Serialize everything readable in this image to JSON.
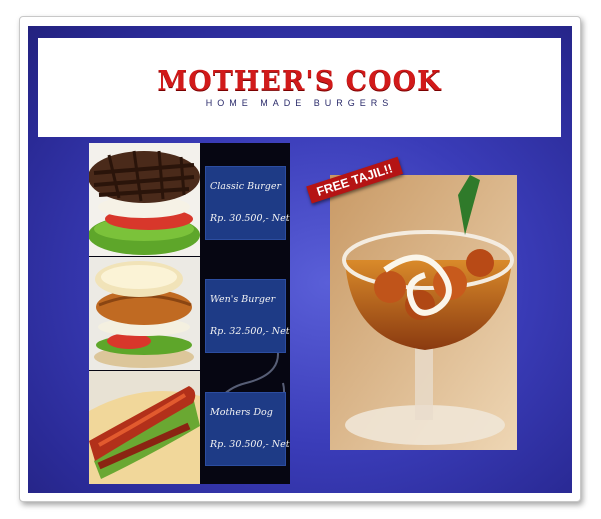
{
  "brand": {
    "name": "MOTHER'S COOK",
    "tagline": "HOME MADE BURGERS"
  },
  "menu": {
    "items": [
      {
        "name": "Classic Burger",
        "price": "Rp. 30.500,- Nett"
      },
      {
        "name": "Wen's Burger",
        "price": "Rp. 32.500,- Nett"
      },
      {
        "name": "Mothers Dog",
        "price": "Rp. 30.500,- Nett"
      }
    ]
  },
  "promo": {
    "ribbon": "FREE TAJIL!!"
  },
  "colors": {
    "panel": "#3a3cb8",
    "brand_red": "#d11a1a",
    "label_blue": "#1e3b86",
    "ribbon_red": "#b51414"
  }
}
